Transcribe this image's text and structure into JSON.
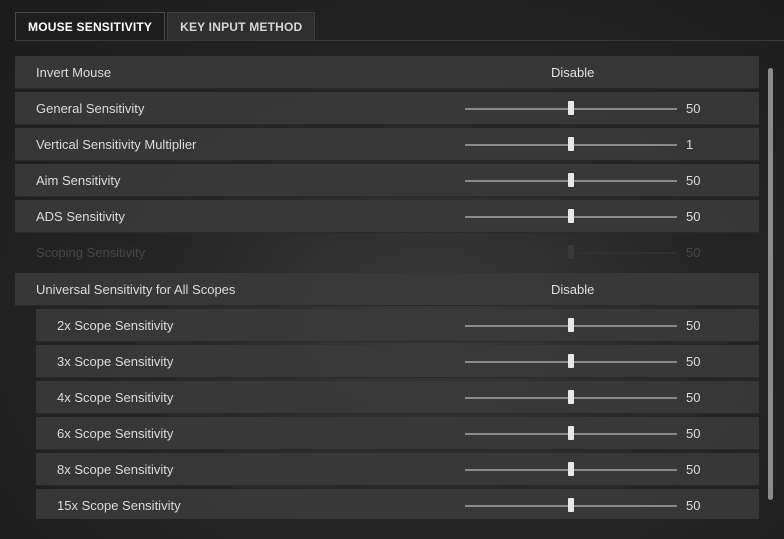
{
  "tabs": [
    {
      "label": "MOUSE SENSITIVITY",
      "active": true
    },
    {
      "label": "KEY INPUT METHOD",
      "active": false
    }
  ],
  "rows": [
    {
      "label": "Invert Mouse",
      "type": "toggle",
      "value": "Disable"
    },
    {
      "label": "General Sensitivity",
      "type": "slider",
      "value": "50",
      "level": 0.5
    },
    {
      "label": "Vertical Sensitivity Multiplier",
      "type": "slider",
      "value": "1",
      "level": 0.5
    },
    {
      "label": "Aim Sensitivity",
      "type": "slider",
      "value": "50",
      "level": 0.5
    },
    {
      "label": "ADS Sensitivity",
      "type": "slider",
      "value": "50",
      "level": 0.5
    },
    {
      "label": "Scoping Sensitivity",
      "type": "slider",
      "value": "50",
      "level": 0.5,
      "disabled": true
    },
    {
      "label": "Universal Sensitivity for All Scopes",
      "type": "toggle",
      "value": "Disable"
    },
    {
      "label": "2x Scope Sensitivity",
      "type": "slider",
      "value": "50",
      "level": 0.5,
      "sub": true
    },
    {
      "label": "3x Scope Sensitivity",
      "type": "slider",
      "value": "50",
      "level": 0.5,
      "sub": true
    },
    {
      "label": "4x Scope Sensitivity",
      "type": "slider",
      "value": "50",
      "level": 0.5,
      "sub": true
    },
    {
      "label": "6x Scope Sensitivity",
      "type": "slider",
      "value": "50",
      "level": 0.5,
      "sub": true
    },
    {
      "label": "8x Scope Sensitivity",
      "type": "slider",
      "value": "50",
      "level": 0.5,
      "sub": true
    },
    {
      "label": "15x Scope Sensitivity",
      "type": "slider",
      "value": "50",
      "level": 0.5,
      "sub": true
    }
  ]
}
